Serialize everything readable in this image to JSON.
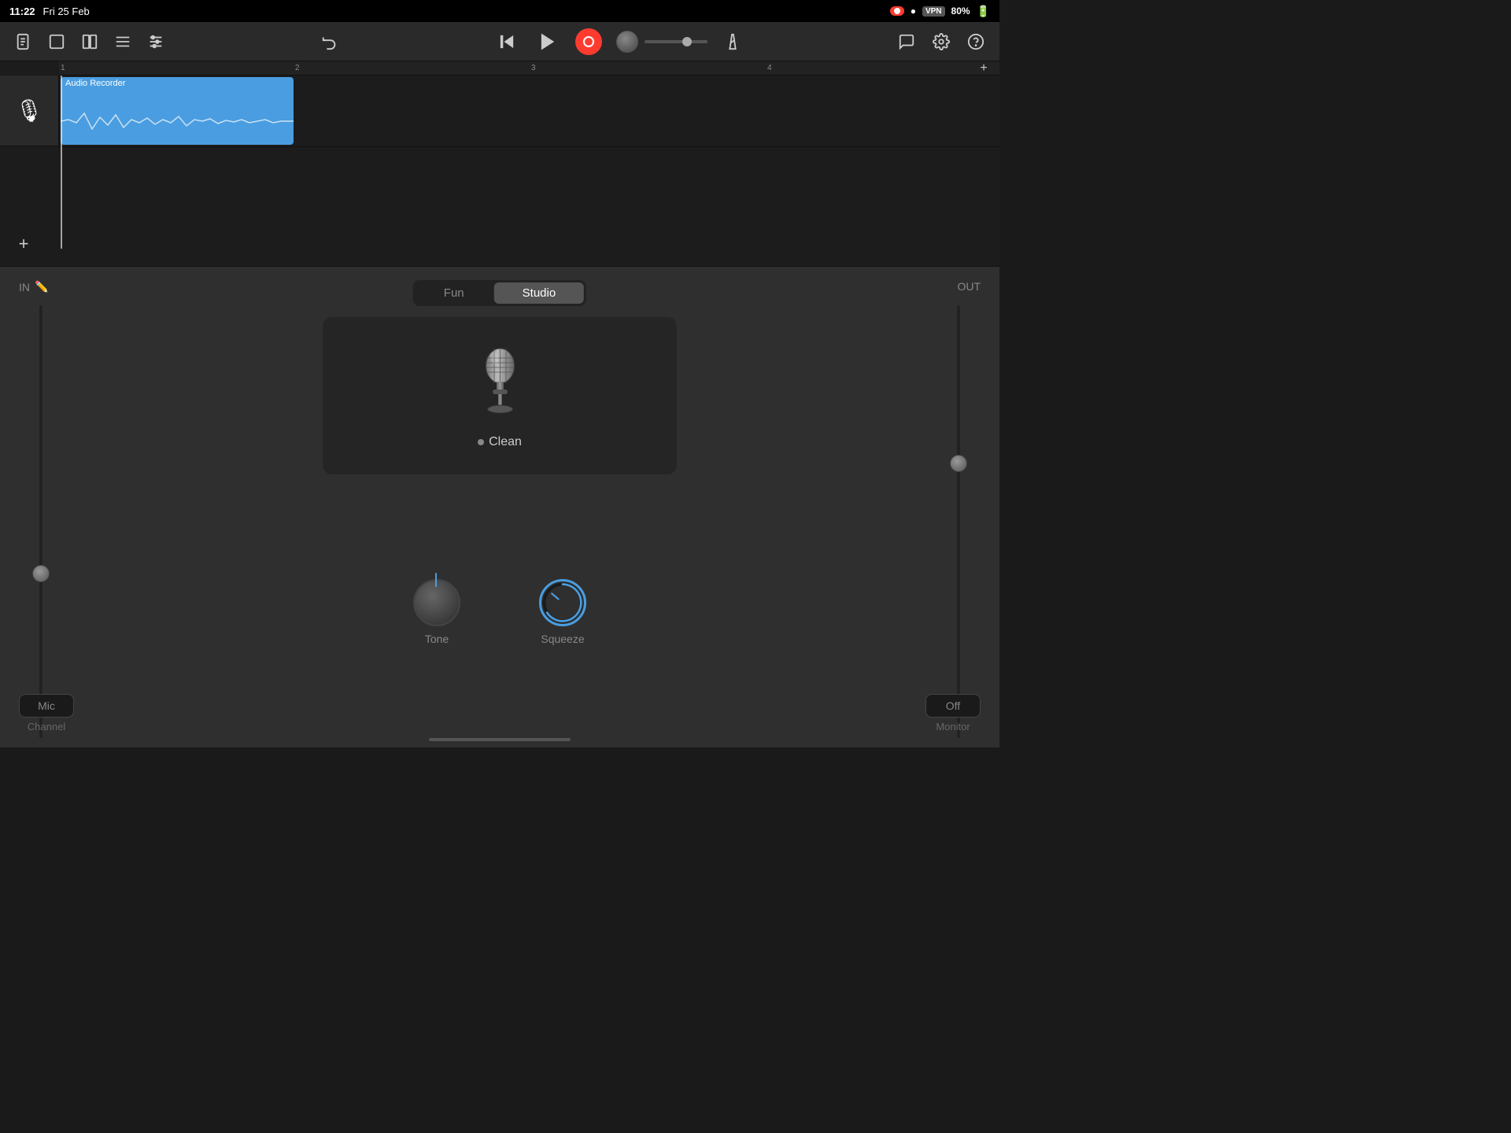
{
  "statusBar": {
    "time": "11:22",
    "date": "Fri 25 Feb",
    "battery": "80%",
    "vpn": "VPN",
    "signal": "●●●"
  },
  "toolbar": {
    "playLabel": "▶",
    "rewindLabel": "⏮",
    "recordLabel": "●",
    "chatIcon": "💬",
    "settingsIcon": "⚙",
    "helpIcon": "?",
    "undoIcon": "↩",
    "viewIcon1": "⬜",
    "viewIcon2": "☰",
    "mixerIcon": "≡"
  },
  "track": {
    "clipLabel": "Audio Recorder",
    "micIcon": "🎙"
  },
  "lowerPanel": {
    "inLabel": "IN",
    "outLabel": "OUT",
    "funTab": "Fun",
    "studioTab": "Studio",
    "activeTab": "Studio",
    "presetName": "Clean",
    "toneLabel": "Tone",
    "squeezeLabel": "Squeeze"
  },
  "bottomBar": {
    "channelBtn": "Mic",
    "channelLabel": "Channel",
    "monitorBtn": "Off",
    "monitorLabel": "Monitor"
  },
  "ruler": {
    "marks": [
      "1",
      "2",
      "3",
      "4"
    ]
  }
}
